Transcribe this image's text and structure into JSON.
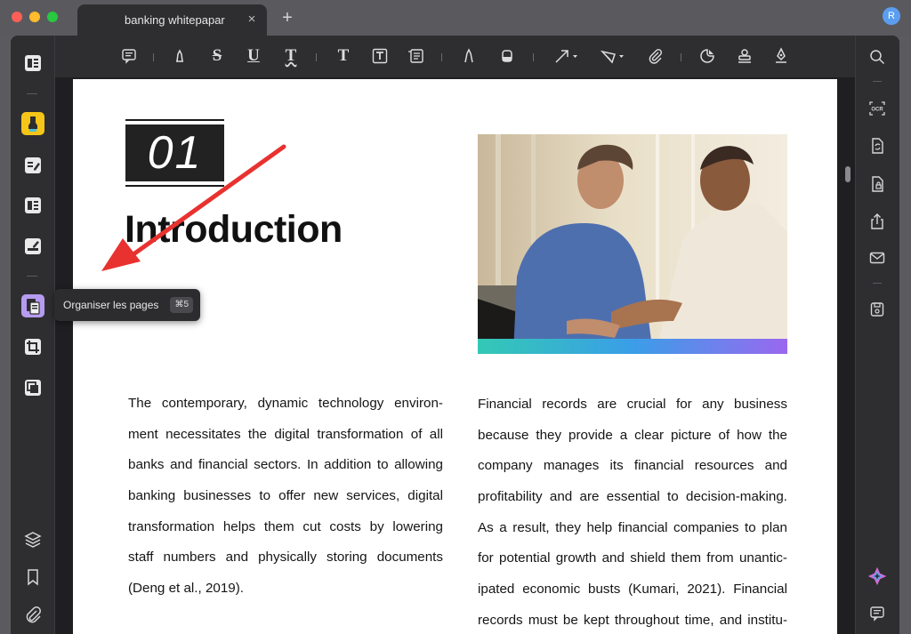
{
  "window": {
    "tab_title": "banking whitepapar",
    "tab_close": "×",
    "new_tab": "+",
    "avatar_initial": "R"
  },
  "left_sidebar": {
    "items": [
      {
        "icon": "reader-icon"
      },
      {
        "icon": "highlighter-icon",
        "active": true
      },
      {
        "icon": "edit-pdf-icon"
      },
      {
        "icon": "form-icon"
      },
      {
        "icon": "fill-sign-icon"
      },
      {
        "icon": "organize-pages-icon"
      },
      {
        "icon": "crop-icon"
      },
      {
        "icon": "page-tools-icon"
      },
      {
        "icon": "layers-icon"
      },
      {
        "icon": "bookmark-icon"
      },
      {
        "icon": "attachment-icon"
      }
    ]
  },
  "toolbar": {
    "tools": [
      "comment-icon",
      "highlight-icon",
      "strikethrough-icon",
      "underline-icon",
      "squiggly-icon",
      "text-icon",
      "text-box-icon",
      "text-callout-icon",
      "pencil-icon",
      "eraser-icon",
      "arrow-icon",
      "shape-icon",
      "attachment-icon",
      "sticker-icon",
      "stamp-icon",
      "signature-icon"
    ],
    "strike_glyph": "S",
    "underline_glyph": "U",
    "squiggly_glyph": "T",
    "text_glyph": "T",
    "textbox_glyph": "T"
  },
  "right_sidebar": {
    "items": [
      "search-icon",
      "ocr-icon",
      "convert-icon",
      "protect-icon",
      "share-icon",
      "email-icon",
      "save-icon",
      "ai-assistant-icon",
      "comments-icon"
    ],
    "ocr_label": "OCR"
  },
  "tooltip": {
    "label": "Organiser les pages",
    "shortcut": "⌘5"
  },
  "document": {
    "chapter_number": "01",
    "title": "Introduction",
    "left_column_lines": [
      "The contemporary, dynamic technology environ-",
      "ment necessitates the digital transformation of all",
      "banks and financial sectors. In addition to allowing",
      "banking businesses to offer new services, digital",
      "transformation helps them cut costs by lowering",
      "staff numbers and physically storing documents",
      "(Deng et al., 2019)."
    ],
    "right_column_lines": [
      "Financial records are crucial for any business",
      "because they provide a clear picture of how the",
      "company manages its financial resources and",
      "profitability and are essential to decision-making.",
      "As a result, they help financial companies to plan",
      "for potential growth and shield them from unantic-",
      "ipated economic busts (Kumari, 2021). Financial",
      "records must be kept throughout time, and institu-"
    ]
  },
  "colors": {
    "accent_highlight": "#f5c518",
    "accent_organize": "#b69cf0",
    "annotation_arrow": "#e8322f"
  }
}
